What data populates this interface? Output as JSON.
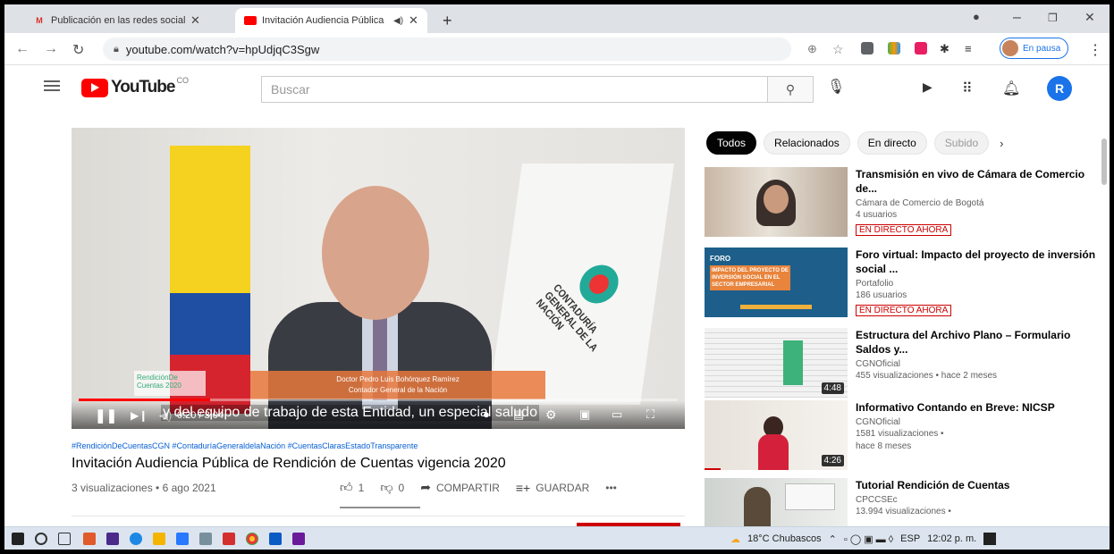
{
  "browser": {
    "tabs": [
      {
        "title": "Publicación en las redes sociales",
        "favicon": "gmail-icon"
      },
      {
        "title": "Invitación Audiencia Pública",
        "favicon": "youtube-icon"
      }
    ],
    "url": "youtube.com/watch?v=hpUdjqC3Sgw",
    "profile_status": "En pausa"
  },
  "youtube": {
    "logo_text": "YouTube",
    "region": "CO",
    "search_placeholder": "Buscar",
    "avatar_letter": "R"
  },
  "video": {
    "caption": "y del equipo de trabajo de esta Entidad, un especial saludo",
    "time": "0:20 / 3:04",
    "progress": 0.22,
    "lower_third_name": "Doctor Pedro Luis Bohórquez Ramírez",
    "lower_third_role": "Contador General de la Nación",
    "badge_text": "RendiciónDe Cuentas 2020",
    "flag_text": "CONTADURÍA GENERAL DE LA NACIÓN"
  },
  "details": {
    "hashtags": "#RendiciónDeCuentasCGN #ContaduríaGeneraldelaNación #CuentasClarasEstadoTransparente",
    "title": "Invitación Audiencia Pública de Rendición de Cuentas vigencia 2020",
    "meta": "3 visualizaciones • 6 ago 2021",
    "likes": "1",
    "dislikes": "0",
    "share_label": "COMPARTIR",
    "save_label": "GUARDAR",
    "more_label": "•••"
  },
  "chips": [
    "Todos",
    "Relacionados",
    "En directo",
    "Subido"
  ],
  "related": [
    {
      "title": "Transmisión en vivo de Cámara de Comercio de...",
      "channel": "Cámara de Comercio de Bogotá",
      "meta": "4 usuarios",
      "live": "EN DIRECTO AHORA",
      "duration": ""
    },
    {
      "title": "Foro virtual: Impacto del proyecto de inversión social ...",
      "channel": "Portafolio",
      "meta": "186 usuarios",
      "live": "EN DIRECTO AHORA",
      "duration": ""
    },
    {
      "title": "Estructura del Archivo Plano – Formulario Saldos y...",
      "channel": "CGNOficial",
      "meta": "455 visualizaciones • hace 2 meses",
      "live": "",
      "duration": "4:48"
    },
    {
      "title": "Informativo Contando en Breve: NICSP",
      "channel": "CGNOficial",
      "meta": "1581 visualizaciones •",
      "meta2": "hace 8 meses",
      "live": "",
      "duration": "4:26"
    },
    {
      "title": "Tutorial Rendición de Cuentas",
      "channel": "CPCCSEc",
      "meta": "13.994 visualizaciones •",
      "live": "",
      "duration": ""
    }
  ],
  "thumb_texts": {
    "foro_label": "FORO",
    "foro_text": "IMPACTO DEL PROYECTO DE INVERSIÓN SOCIAL EN EL SECTOR EMPRESARIAL"
  },
  "taskbar": {
    "weather": "18°C Chubascos",
    "lang": "ESP",
    "time": "12:02 p. m."
  },
  "colors": {
    "youtube_red": "#ff0000",
    "link_blue": "#065fd4",
    "live_red": "#cc0000",
    "accent_blue": "#1a73e8"
  }
}
